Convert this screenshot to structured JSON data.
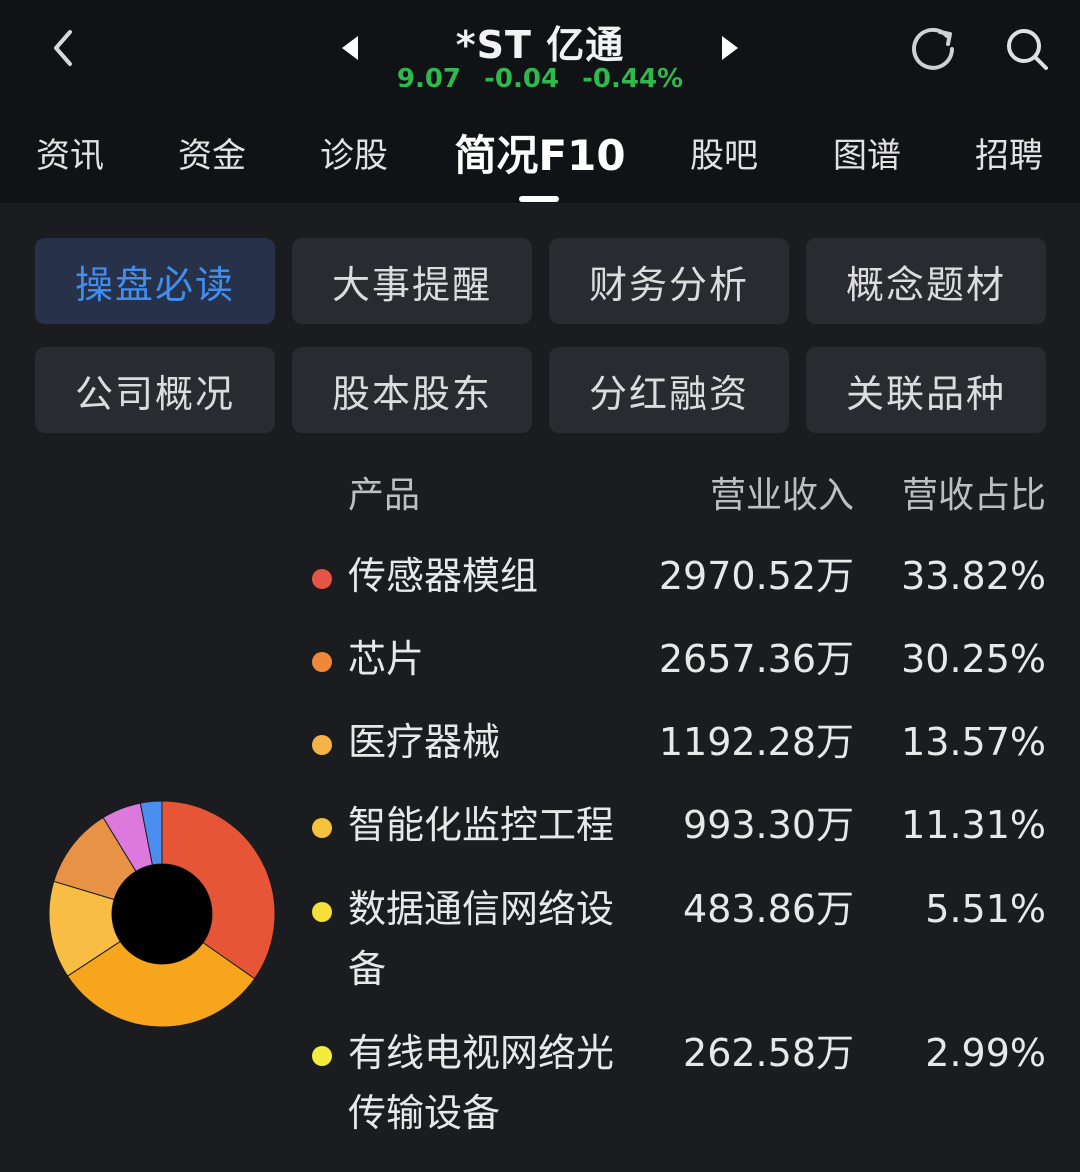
{
  "header": {
    "title": "*ST 亿通",
    "price": "9.07",
    "change": "-0.04",
    "change_pct": "-0.44%",
    "icons": [
      "back-arrow-icon",
      "prev-triangle-icon",
      "next-triangle-icon",
      "refresh-icon",
      "search-icon"
    ]
  },
  "tabs": [
    {
      "label": "资讯"
    },
    {
      "label": "资金"
    },
    {
      "label": "诊股"
    },
    {
      "label": "简况F10",
      "active": true
    },
    {
      "label": "股吧"
    },
    {
      "label": "图谱"
    },
    {
      "label": "招聘"
    }
  ],
  "subnav": [
    {
      "label": "操盘必读",
      "active": true
    },
    {
      "label": "大事提醒"
    },
    {
      "label": "财务分析"
    },
    {
      "label": "概念题材"
    },
    {
      "label": "公司概况"
    },
    {
      "label": "股本股东"
    },
    {
      "label": "分红融资"
    },
    {
      "label": "关联品种"
    }
  ],
  "table": {
    "headers": {
      "product": "产品",
      "revenue": "营业收入",
      "ratio": "营收占比"
    },
    "rows": [
      {
        "name": "传感器模组",
        "revenue": "2970.52万",
        "ratio": "33.82%",
        "color": "#e65448"
      },
      {
        "name": "芯片",
        "revenue": "2657.36万",
        "ratio": "30.25%",
        "color": "#f0883a"
      },
      {
        "name": "医疗器械",
        "revenue": "1192.28万",
        "ratio": "13.57%",
        "color": "#f5b347"
      },
      {
        "name": "智能化监控工程",
        "revenue": "993.30万",
        "ratio": "11.31%",
        "color": "#f5c23d"
      },
      {
        "name": "数据通信网络设备",
        "revenue": "483.86万",
        "ratio": "5.51%",
        "color": "#f5e03a"
      },
      {
        "name": "有线电视网络光传输设备",
        "revenue": "262.58万",
        "ratio": "2.99%",
        "color": "#f2ec3c"
      }
    ]
  },
  "chart_data": {
    "type": "pie",
    "labels": [
      "传感器模组",
      "芯片",
      "医疗器械",
      "智能化监控工程",
      "数据通信网络设备",
      "有线电视网络光传输设备"
    ],
    "values": [
      33.82,
      30.25,
      13.57,
      11.31,
      5.51,
      2.99
    ],
    "colors": [
      "#e65536",
      "#f7a51c",
      "#f7bd45",
      "#e89245",
      "#dd78dc",
      "#4b8ef0",
      "#59c7d6"
    ],
    "donut": true
  }
}
